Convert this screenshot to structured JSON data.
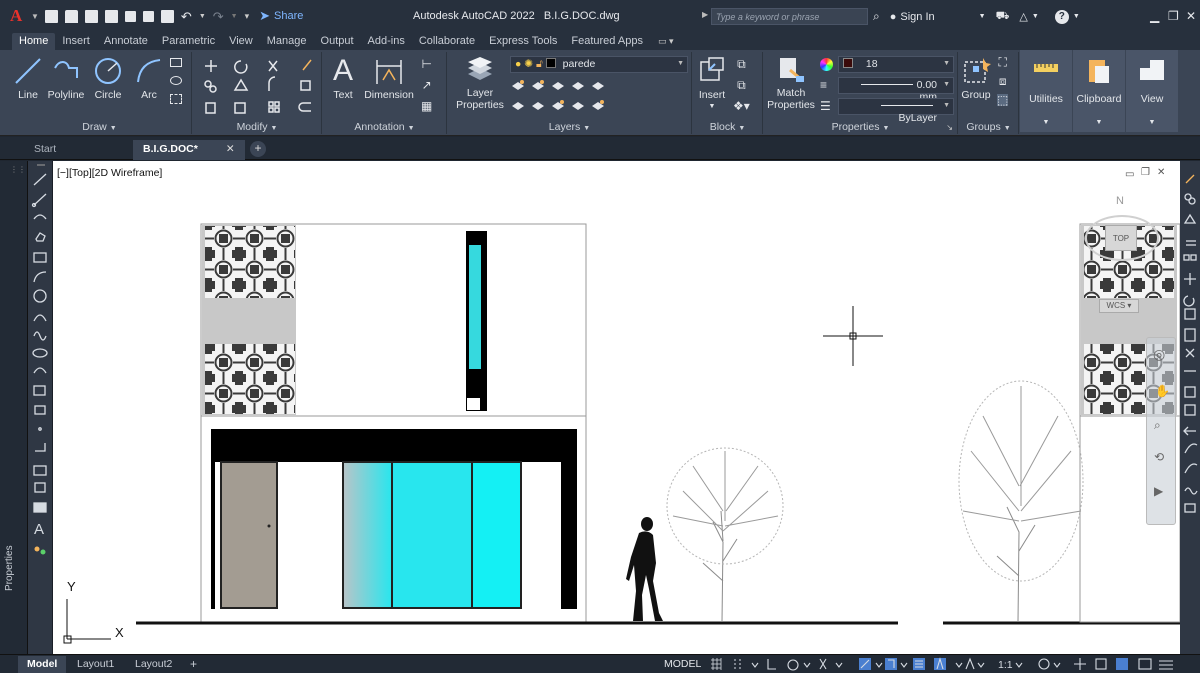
{
  "app": {
    "logo": "A",
    "title": "Autodesk AutoCAD 2022",
    "file": "B.I.G.DOC.dwg",
    "share_label": "Share",
    "search_placeholder": "Type a keyword or phrase",
    "sign_in": "Sign In"
  },
  "ribbon_tabs": [
    "Home",
    "Insert",
    "Annotate",
    "Parametric",
    "View",
    "Manage",
    "Output",
    "Add-ins",
    "Collaborate",
    "Express Tools",
    "Featured Apps"
  ],
  "draw_panel": {
    "title": "Draw",
    "tools": [
      "Line",
      "Polyline",
      "Circle",
      "Arc"
    ]
  },
  "modify_panel": {
    "title": "Modify"
  },
  "annotation_panel": {
    "title": "Annotation",
    "tools": [
      "Text",
      "Dimension"
    ]
  },
  "layers_panel": {
    "title": "Layers",
    "tool_line1": "Layer",
    "tool_line2": "Properties",
    "current_layer": "parede"
  },
  "block_panel": {
    "title": "Block",
    "tool": "Insert"
  },
  "properties_panel": {
    "title": "Properties",
    "tool_line1": "Match",
    "tool_line2": "Properties",
    "color_value": "18",
    "lineweight": "0.00 mm",
    "linetype": "ByLayer"
  },
  "groups_panel": {
    "title": "Groups",
    "tool": "Group"
  },
  "utilities": "Utilities",
  "clipboard": "Clipboard",
  "view": "View",
  "file_tabs": {
    "start": "Start",
    "active": "B.I.G.DOC*",
    "close": "✕",
    "add": "+"
  },
  "left_palette_label": "Properties",
  "viewport_label": "[−][Top][2D Wireframe]",
  "viewcube": {
    "north": "N",
    "top": "TOP",
    "wcs": "WCS"
  },
  "ucs": {
    "x": "X",
    "y": "Y"
  },
  "layout_tabs": [
    "Model",
    "Layout1",
    "Layout2"
  ],
  "status": {
    "model": "MODEL",
    "scale": "1:1"
  },
  "colors": {
    "background": "#1f2630",
    "ribbon": "#3b4555",
    "canvas": "#ffffff",
    "glass": "#1ff0f0",
    "door": "#a39c92",
    "accent": "#7fb6ff"
  }
}
